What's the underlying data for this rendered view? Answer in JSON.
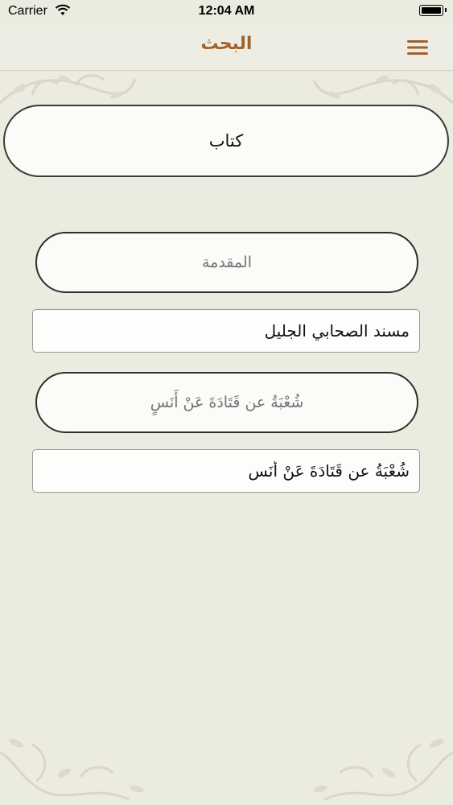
{
  "status_bar": {
    "carrier": "Carrier",
    "time": "12:04 AM"
  },
  "nav": {
    "title": "البحث",
    "menu_icon": "hamburger-menu-icon"
  },
  "book": {
    "label": "كتاب"
  },
  "sections": [
    {
      "button_label": "المقدمة",
      "field_value": "مسند الصحابي الجليل"
    },
    {
      "button_label": "شُعْبَةُ عن قَتَادَةَ عَنْ أَنَسٍ",
      "field_value": "شُعْبَةُ عن قَتَادَةَ عَنْ أَنَسٍ"
    }
  ],
  "colors": {
    "background": "#ecebe0",
    "title": "#a0622b",
    "menu_icon": "#a0622b",
    "button_text": "#6f757a"
  }
}
